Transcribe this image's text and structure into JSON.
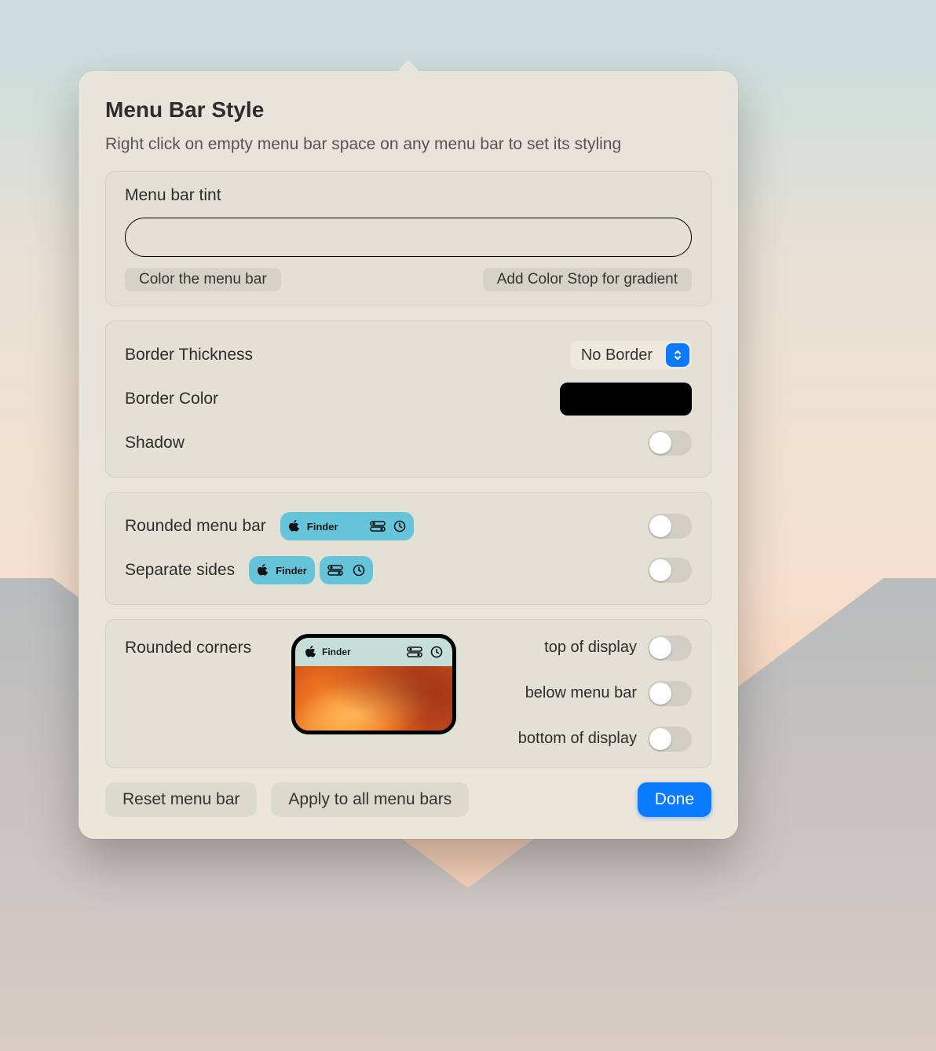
{
  "title": "Menu Bar Style",
  "subtitle": "Right click on empty menu bar space on any menu bar to set its styling",
  "tint": {
    "label": "Menu bar tint",
    "color_btn": "Color the menu bar",
    "gradient_btn": "Add Color Stop for gradient"
  },
  "border": {
    "thickness_label": "Border Thickness",
    "thickness_value": "No Border",
    "color_label": "Border Color",
    "color_value": "#000000",
    "shadow_label": "Shadow",
    "shadow_on": false
  },
  "rounded": {
    "menu_bar_label": "Rounded menu bar",
    "menu_bar_on": false,
    "separate_label": "Separate sides",
    "separate_on": false,
    "preview_app": "Finder"
  },
  "corners": {
    "label": "Rounded corners",
    "preview_app": "Finder",
    "top_label": "top of display",
    "top_on": false,
    "below_label": "below menu bar",
    "below_on": false,
    "bottom_label": "bottom of display",
    "bottom_on": false
  },
  "footer": {
    "reset": "Reset menu bar",
    "apply_all": "Apply to all menu bars",
    "done": "Done"
  }
}
